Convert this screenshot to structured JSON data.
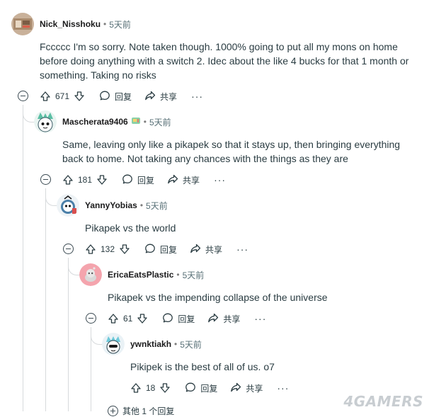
{
  "comments": [
    {
      "username": "Nick_Nisshoku",
      "separator": "•",
      "time": "5天前",
      "body": "Fccccc I'm so sorry. Note taken though. 1000% going to put all my mons on home before doing anything with a switch 2. Idec about the like 4 bucks for that 1 month or something. Taking no risks",
      "score": "671",
      "reply_label": "回复",
      "share_label": "共享",
      "more_label": "···",
      "avatar_icon": "user-avatar-1"
    },
    {
      "username": "Mascherata9406",
      "separator": "•",
      "time": "5天前",
      "body": "Same, leaving only like a pikapek so that it stays up, then bringing everything back to home. Not taking any chances with the things as they are",
      "score": "181",
      "reply_label": "回复",
      "share_label": "共享",
      "more_label": "···",
      "avatar_icon": "user-avatar-2"
    },
    {
      "username": "YannyYobias",
      "separator": "•",
      "time": "5天前",
      "body": "Pikapek vs the world",
      "score": "132",
      "reply_label": "回复",
      "share_label": "共享",
      "more_label": "···",
      "avatar_icon": "user-avatar-3"
    },
    {
      "username": "EricaEatsPlastic",
      "separator": "•",
      "time": "5天前",
      "body": "Pikapek vs the impending collapse of the universe",
      "score": "61",
      "reply_label": "回复",
      "share_label": "共享",
      "more_label": "···",
      "avatar_icon": "user-avatar-4"
    },
    {
      "username": "ywnktiakh",
      "separator": "•",
      "time": "5天前",
      "body": "Pikipek is the best of all of us. o7",
      "score": "18",
      "reply_label": "回复",
      "share_label": "共享",
      "more_label": "···",
      "avatar_icon": "user-avatar-5"
    }
  ],
  "more_replies": "其他 1 个回复",
  "watermark": "4GAMERS",
  "colors": {
    "text": "#2a3c42",
    "username": "#1a1a1b",
    "meta": "#576f76",
    "thread_line": "#d7dadc"
  }
}
